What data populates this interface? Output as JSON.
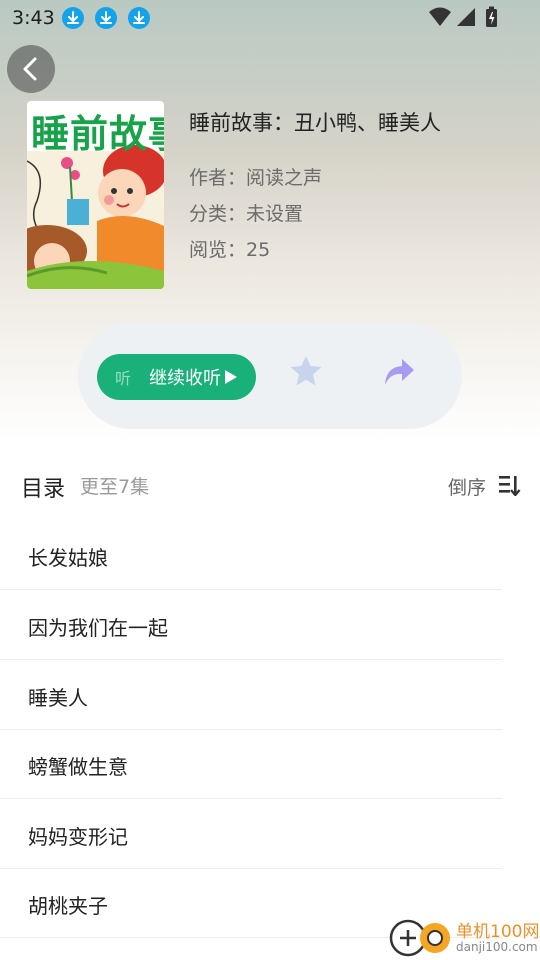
{
  "status_bar": {
    "time": "3:43"
  },
  "book": {
    "cover_title": "睡前故事",
    "title": "睡前故事：丑小鸭、睡美人",
    "author": "作者：阅读之声",
    "category": "分类：未设置",
    "views": "阅览：25"
  },
  "actions": {
    "listen_ghost": "听",
    "listen_label": "继续收听"
  },
  "toc": {
    "title": "目录",
    "count": "更至7集",
    "sort_label": "倒序",
    "episodes": [
      "长发姑娘",
      "因为我们在一起",
      "睡美人",
      "螃蟹做生意",
      "妈妈变形记",
      "胡桃夹子"
    ]
  },
  "watermark": {
    "name": "单机100网",
    "url": "danji100.com"
  },
  "colors": {
    "accent_green": "#19b07a",
    "download_blue": "#14a3e8",
    "share_purple": "#a79cf0",
    "star_blue": "#c8d4ec"
  },
  "icons": [
    "download-icon",
    "wifi-icon",
    "signal-icon",
    "battery-icon",
    "back-arrow-icon",
    "play-icon",
    "star-icon",
    "share-icon",
    "sort-icon"
  ]
}
